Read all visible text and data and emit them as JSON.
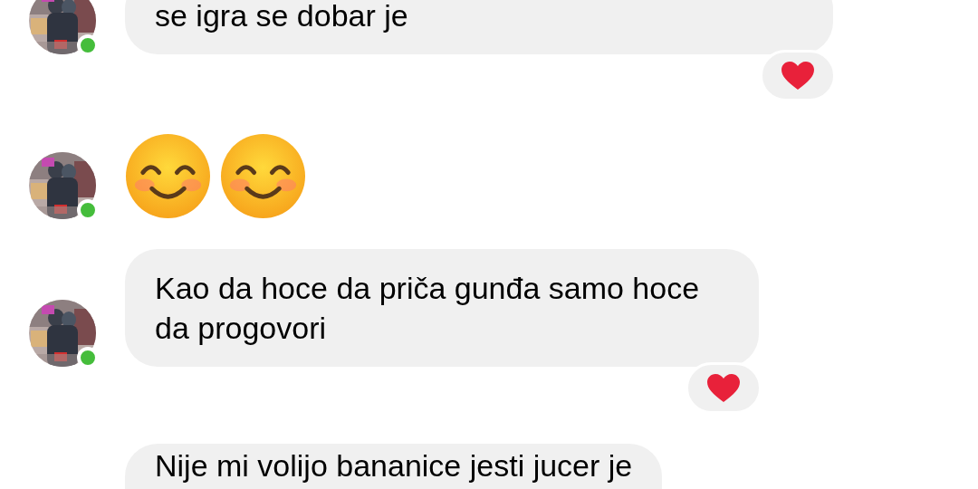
{
  "messages": [
    {
      "kind": "text",
      "text": "se igra se dobar je",
      "avatar": {
        "online": true
      },
      "reaction": {
        "kind": "heart"
      }
    },
    {
      "kind": "emoji",
      "faces": [
        {
          "kind": "smiling-eyes"
        },
        {
          "kind": "smiling-eyes"
        }
      ],
      "avatar": {
        "online": true
      }
    },
    {
      "kind": "text",
      "text": "Kao da hoce da priča gunđa samo hoce da progovori",
      "avatar": {
        "online": true
      },
      "reaction": {
        "kind": "heart"
      }
    },
    {
      "kind": "text",
      "text": "Nije mi volijo bananice jesti jucer je"
    }
  ]
}
